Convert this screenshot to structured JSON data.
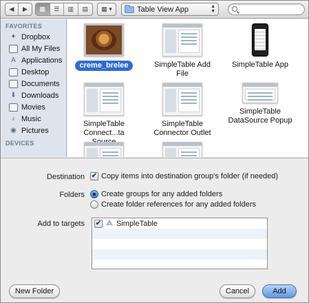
{
  "toolbar": {
    "back_icon": "back-arrow-icon",
    "forward_icon": "forward-arrow-icon",
    "view_modes": [
      "icon-view-icon",
      "list-view-icon",
      "column-view-icon",
      "coverflow-view-icon"
    ],
    "arrange_icon": "arrange-grid-icon",
    "location": "Table View App",
    "search_placeholder": ""
  },
  "sidebar": {
    "favorites_header": "FAVORITES",
    "favorites": [
      {
        "label": "Dropbox",
        "icon": "dropbox-icon"
      },
      {
        "label": "All My Files",
        "icon": "all-files-icon"
      },
      {
        "label": "Applications",
        "icon": "applications-icon"
      },
      {
        "label": "Desktop",
        "icon": "desktop-icon"
      },
      {
        "label": "Documents",
        "icon": "documents-icon"
      },
      {
        "label": "Downloads",
        "icon": "downloads-icon"
      },
      {
        "label": "Movies",
        "icon": "movies-icon"
      },
      {
        "label": "Music",
        "icon": "music-icon"
      },
      {
        "label": "Pictures",
        "icon": "pictures-icon"
      }
    ],
    "devices_header": "DEVICES"
  },
  "files": [
    {
      "label": "creme_brelee",
      "selected": true,
      "kind": "photo"
    },
    {
      "label": "SimpleTable Add File",
      "selected": false,
      "kind": "screenshot"
    },
    {
      "label": "SimpleTable App",
      "selected": false,
      "kind": "phone"
    },
    {
      "label": "SimpleTable Connect...ta Source",
      "selected": false,
      "kind": "screenshot"
    },
    {
      "label": "SimpleTable Connector Outlet",
      "selected": false,
      "kind": "screenshot"
    },
    {
      "label": "SimpleTable DataSource Popup",
      "selected": false,
      "kind": "small"
    },
    {
      "label": "",
      "selected": false,
      "kind": "screenshot"
    },
    {
      "label": "",
      "selected": false,
      "kind": "screenshot"
    }
  ],
  "options": {
    "destination_label": "Destination",
    "destination_checkbox": "Copy items into destination group's folder (if needed)",
    "destination_checked": true,
    "folders_label": "Folders",
    "folders_radio_1": "Create groups for any added folders",
    "folders_radio_2": "Create folder references for any added folders",
    "folders_selected": 1,
    "targets_label": "Add to targets",
    "targets": [
      {
        "label": "SimpleTable",
        "checked": true,
        "icon": "app-target-icon"
      }
    ]
  },
  "footer": {
    "new_folder": "New Folder",
    "cancel": "Cancel",
    "add": "Add"
  },
  "colors": {
    "selection": "#2f6bd6",
    "sidebar_bg": "#dde4ed",
    "primary_button": "#5c98e6"
  }
}
